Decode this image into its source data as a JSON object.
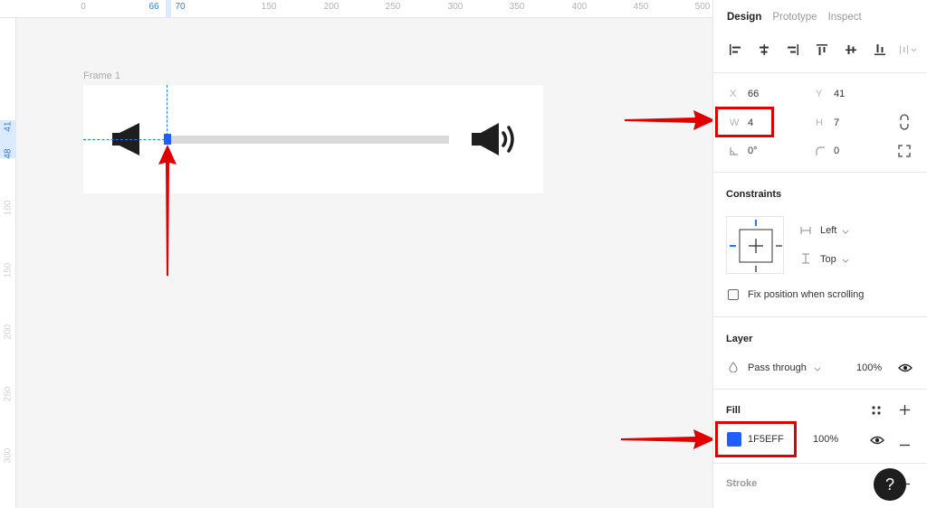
{
  "rulers": {
    "top": [
      "0",
      "66",
      "70",
      "150",
      "200",
      "250",
      "300",
      "350",
      "400",
      "450",
      "500"
    ],
    "left": [
      "41",
      "48",
      "100",
      "150",
      "200",
      "250",
      "300"
    ]
  },
  "canvas": {
    "frame_label": "Frame 1",
    "accent_color": "#1F5EFF",
    "annotation_color": "#E00000"
  },
  "panel": {
    "tabs": [
      "Design",
      "Prototype",
      "Inspect"
    ],
    "position": {
      "x_label": "X",
      "x_value": "66",
      "y_label": "Y",
      "y_value": "41",
      "w_label": "W",
      "w_value": "4",
      "h_label": "H",
      "h_value": "7",
      "rotation_value": "0°",
      "radius_value": "0"
    },
    "constraints": {
      "title": "Constraints",
      "horizontal": "Left",
      "vertical": "Top",
      "fix_label": "Fix position when scrolling"
    },
    "layer": {
      "title": "Layer",
      "blend": "Pass through",
      "opacity": "100%"
    },
    "fill": {
      "title": "Fill",
      "hex": "1F5EFF",
      "opacity": "100%"
    },
    "stroke": {
      "title": "Stroke"
    },
    "help": "?"
  }
}
